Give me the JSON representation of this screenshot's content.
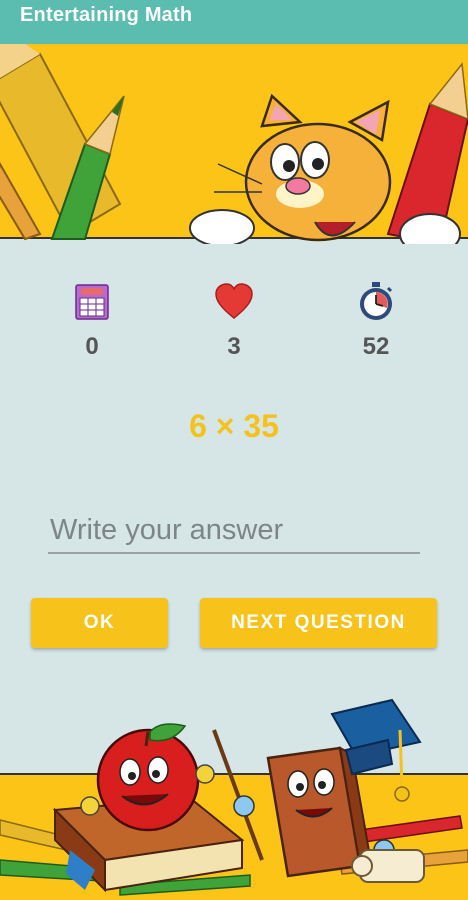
{
  "app": {
    "title": "Entertaining Math"
  },
  "stats": {
    "score": {
      "icon": "scoreboard-icon",
      "value": "0"
    },
    "lives": {
      "icon": "heart-icon",
      "value": "3"
    },
    "timer": {
      "icon": "stopwatch-icon",
      "value": "52"
    }
  },
  "question": {
    "text": "6 × 35"
  },
  "answer": {
    "placeholder": "Write your answer",
    "value": ""
  },
  "buttons": {
    "ok": "OK",
    "next": "NEXT QUESTION"
  },
  "colors": {
    "app_bar": "#5bbcb0",
    "banner": "#fbc417",
    "background": "#d6e6e6",
    "accent": "#f7c21a",
    "stat_text": "#555555"
  },
  "illustrations": {
    "top": "cartoon cat with pencils",
    "bottom": "cartoon apple and book characters with pencils"
  }
}
